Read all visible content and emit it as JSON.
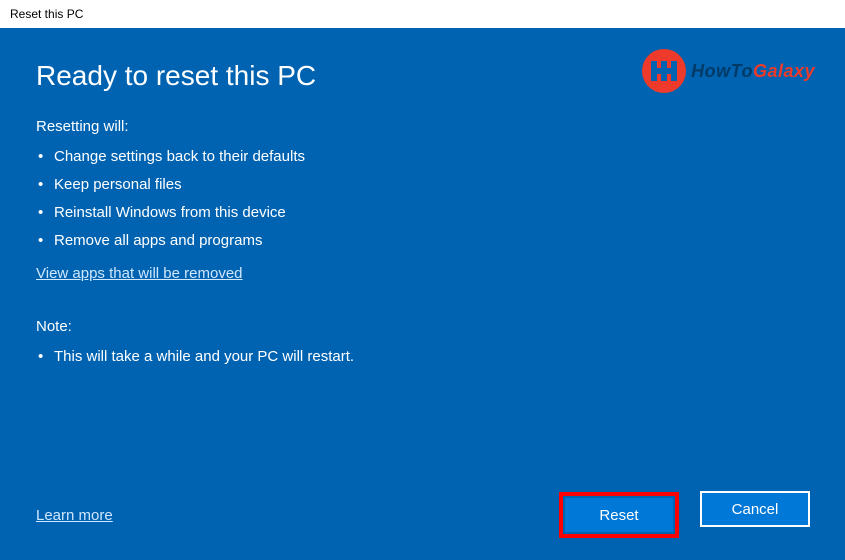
{
  "window": {
    "title": "Reset this PC"
  },
  "main": {
    "heading": "Ready to reset this PC",
    "resetting_label": "Resetting will:",
    "bullets": [
      "Change settings back to their defaults",
      "Keep personal files",
      "Reinstall Windows from this device",
      "Remove all apps and programs"
    ],
    "view_apps_link": "View apps that will be removed",
    "note_label": "Note:",
    "note_bullets": [
      "This will take a while and your PC will restart."
    ]
  },
  "footer": {
    "learn_more": "Learn more",
    "reset_button": "Reset",
    "cancel_button": "Cancel"
  },
  "watermark": {
    "text_how": "HowTo",
    "text_galaxy": "Galaxy"
  }
}
